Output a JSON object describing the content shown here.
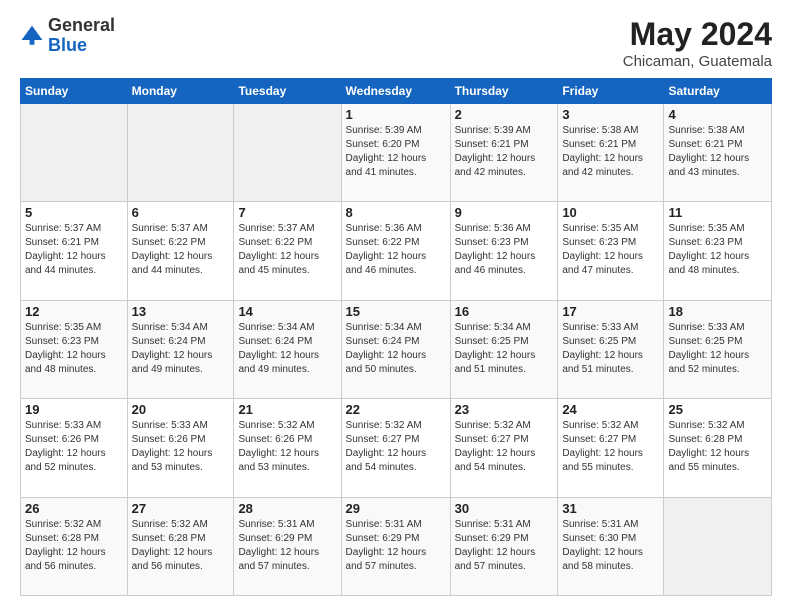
{
  "logo": {
    "general": "General",
    "blue": "Blue"
  },
  "header": {
    "month": "May 2024",
    "location": "Chicaman, Guatemala"
  },
  "weekdays": [
    "Sunday",
    "Monday",
    "Tuesday",
    "Wednesday",
    "Thursday",
    "Friday",
    "Saturday"
  ],
  "weeks": [
    [
      {
        "day": "",
        "sunrise": "",
        "sunset": "",
        "daylight": ""
      },
      {
        "day": "",
        "sunrise": "",
        "sunset": "",
        "daylight": ""
      },
      {
        "day": "",
        "sunrise": "",
        "sunset": "",
        "daylight": ""
      },
      {
        "day": "1",
        "sunrise": "Sunrise: 5:39 AM",
        "sunset": "Sunset: 6:20 PM",
        "daylight": "Daylight: 12 hours and 41 minutes."
      },
      {
        "day": "2",
        "sunrise": "Sunrise: 5:39 AM",
        "sunset": "Sunset: 6:21 PM",
        "daylight": "Daylight: 12 hours and 42 minutes."
      },
      {
        "day": "3",
        "sunrise": "Sunrise: 5:38 AM",
        "sunset": "Sunset: 6:21 PM",
        "daylight": "Daylight: 12 hours and 42 minutes."
      },
      {
        "day": "4",
        "sunrise": "Sunrise: 5:38 AM",
        "sunset": "Sunset: 6:21 PM",
        "daylight": "Daylight: 12 hours and 43 minutes."
      }
    ],
    [
      {
        "day": "5",
        "sunrise": "Sunrise: 5:37 AM",
        "sunset": "Sunset: 6:21 PM",
        "daylight": "Daylight: 12 hours and 44 minutes."
      },
      {
        "day": "6",
        "sunrise": "Sunrise: 5:37 AM",
        "sunset": "Sunset: 6:22 PM",
        "daylight": "Daylight: 12 hours and 44 minutes."
      },
      {
        "day": "7",
        "sunrise": "Sunrise: 5:37 AM",
        "sunset": "Sunset: 6:22 PM",
        "daylight": "Daylight: 12 hours and 45 minutes."
      },
      {
        "day": "8",
        "sunrise": "Sunrise: 5:36 AM",
        "sunset": "Sunset: 6:22 PM",
        "daylight": "Daylight: 12 hours and 46 minutes."
      },
      {
        "day": "9",
        "sunrise": "Sunrise: 5:36 AM",
        "sunset": "Sunset: 6:23 PM",
        "daylight": "Daylight: 12 hours and 46 minutes."
      },
      {
        "day": "10",
        "sunrise": "Sunrise: 5:35 AM",
        "sunset": "Sunset: 6:23 PM",
        "daylight": "Daylight: 12 hours and 47 minutes."
      },
      {
        "day": "11",
        "sunrise": "Sunrise: 5:35 AM",
        "sunset": "Sunset: 6:23 PM",
        "daylight": "Daylight: 12 hours and 48 minutes."
      }
    ],
    [
      {
        "day": "12",
        "sunrise": "Sunrise: 5:35 AM",
        "sunset": "Sunset: 6:23 PM",
        "daylight": "Daylight: 12 hours and 48 minutes."
      },
      {
        "day": "13",
        "sunrise": "Sunrise: 5:34 AM",
        "sunset": "Sunset: 6:24 PM",
        "daylight": "Daylight: 12 hours and 49 minutes."
      },
      {
        "day": "14",
        "sunrise": "Sunrise: 5:34 AM",
        "sunset": "Sunset: 6:24 PM",
        "daylight": "Daylight: 12 hours and 49 minutes."
      },
      {
        "day": "15",
        "sunrise": "Sunrise: 5:34 AM",
        "sunset": "Sunset: 6:24 PM",
        "daylight": "Daylight: 12 hours and 50 minutes."
      },
      {
        "day": "16",
        "sunrise": "Sunrise: 5:34 AM",
        "sunset": "Sunset: 6:25 PM",
        "daylight": "Daylight: 12 hours and 51 minutes."
      },
      {
        "day": "17",
        "sunrise": "Sunrise: 5:33 AM",
        "sunset": "Sunset: 6:25 PM",
        "daylight": "Daylight: 12 hours and 51 minutes."
      },
      {
        "day": "18",
        "sunrise": "Sunrise: 5:33 AM",
        "sunset": "Sunset: 6:25 PM",
        "daylight": "Daylight: 12 hours and 52 minutes."
      }
    ],
    [
      {
        "day": "19",
        "sunrise": "Sunrise: 5:33 AM",
        "sunset": "Sunset: 6:26 PM",
        "daylight": "Daylight: 12 hours and 52 minutes."
      },
      {
        "day": "20",
        "sunrise": "Sunrise: 5:33 AM",
        "sunset": "Sunset: 6:26 PM",
        "daylight": "Daylight: 12 hours and 53 minutes."
      },
      {
        "day": "21",
        "sunrise": "Sunrise: 5:32 AM",
        "sunset": "Sunset: 6:26 PM",
        "daylight": "Daylight: 12 hours and 53 minutes."
      },
      {
        "day": "22",
        "sunrise": "Sunrise: 5:32 AM",
        "sunset": "Sunset: 6:27 PM",
        "daylight": "Daylight: 12 hours and 54 minutes."
      },
      {
        "day": "23",
        "sunrise": "Sunrise: 5:32 AM",
        "sunset": "Sunset: 6:27 PM",
        "daylight": "Daylight: 12 hours and 54 minutes."
      },
      {
        "day": "24",
        "sunrise": "Sunrise: 5:32 AM",
        "sunset": "Sunset: 6:27 PM",
        "daylight": "Daylight: 12 hours and 55 minutes."
      },
      {
        "day": "25",
        "sunrise": "Sunrise: 5:32 AM",
        "sunset": "Sunset: 6:28 PM",
        "daylight": "Daylight: 12 hours and 55 minutes."
      }
    ],
    [
      {
        "day": "26",
        "sunrise": "Sunrise: 5:32 AM",
        "sunset": "Sunset: 6:28 PM",
        "daylight": "Daylight: 12 hours and 56 minutes."
      },
      {
        "day": "27",
        "sunrise": "Sunrise: 5:32 AM",
        "sunset": "Sunset: 6:28 PM",
        "daylight": "Daylight: 12 hours and 56 minutes."
      },
      {
        "day": "28",
        "sunrise": "Sunrise: 5:31 AM",
        "sunset": "Sunset: 6:29 PM",
        "daylight": "Daylight: 12 hours and 57 minutes."
      },
      {
        "day": "29",
        "sunrise": "Sunrise: 5:31 AM",
        "sunset": "Sunset: 6:29 PM",
        "daylight": "Daylight: 12 hours and 57 minutes."
      },
      {
        "day": "30",
        "sunrise": "Sunrise: 5:31 AM",
        "sunset": "Sunset: 6:29 PM",
        "daylight": "Daylight: 12 hours and 57 minutes."
      },
      {
        "day": "31",
        "sunrise": "Sunrise: 5:31 AM",
        "sunset": "Sunset: 6:30 PM",
        "daylight": "Daylight: 12 hours and 58 minutes."
      },
      {
        "day": "",
        "sunrise": "",
        "sunset": "",
        "daylight": ""
      }
    ]
  ]
}
